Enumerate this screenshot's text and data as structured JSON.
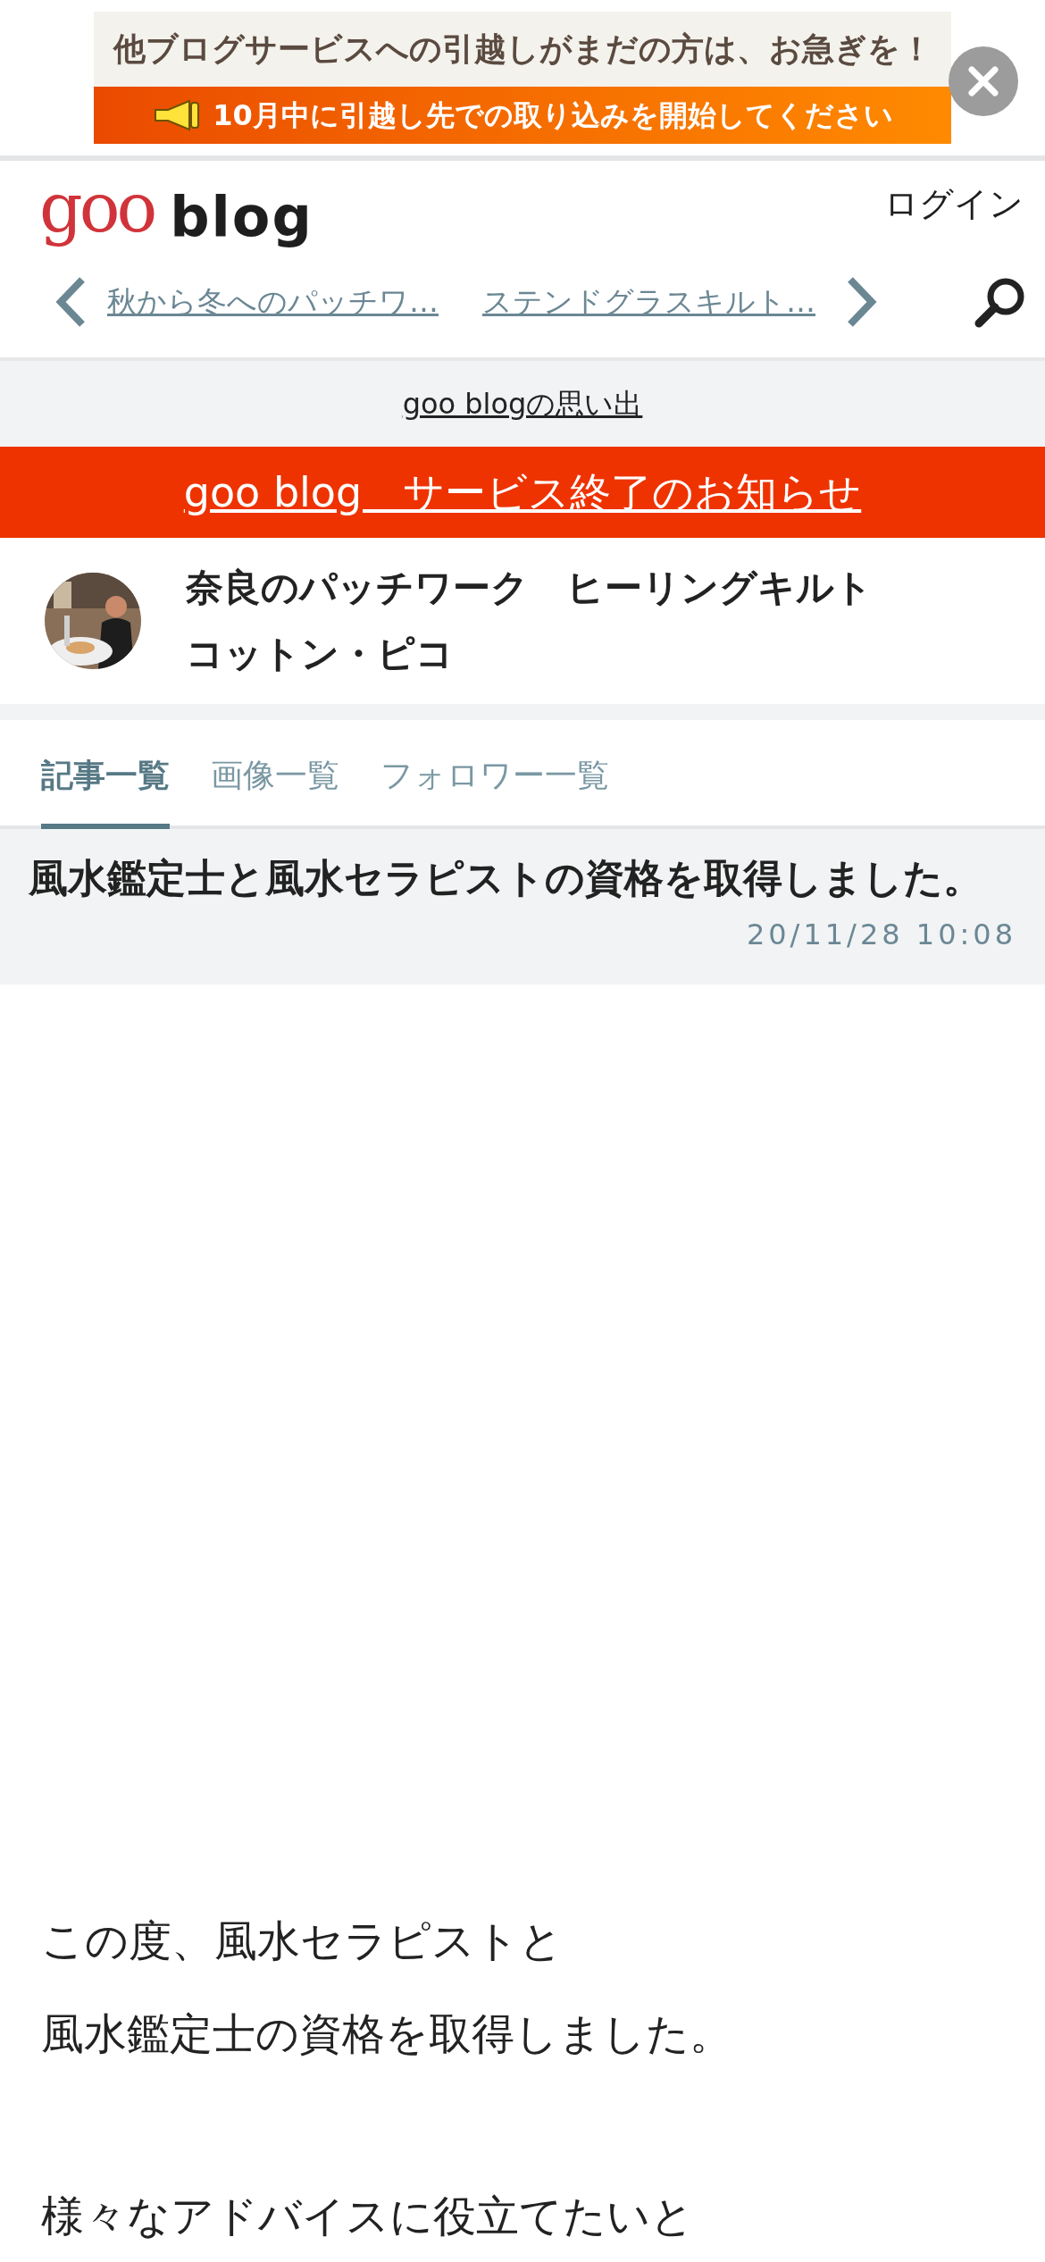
{
  "ad_banner": {
    "headline": "他ブログサービスへの引越しがまだの方は、お急ぎを！",
    "subline": "10月中に引越し先での取り込みを開始してください"
  },
  "header": {
    "logo_mark": "goo",
    "logo_text": "blog",
    "login": "ログイン"
  },
  "article_nav": {
    "previous": "秋から冬へのパッチワ…",
    "next": "ステンドグラスキルト…"
  },
  "memories_link": "goo blogの思い出",
  "notice_link": "goo blog　サービス終了のお知らせ",
  "blog": {
    "title_lines": [
      "奈良のパッチワーク　ヒーリングキルト",
      "コットン・ピコ"
    ]
  },
  "tabs": [
    {
      "label": "記事一覧",
      "selected": true
    },
    {
      "label": "画像一覧",
      "selected": false
    },
    {
      "label": "フォロワー一覧",
      "selected": false
    }
  ],
  "article": {
    "title": "風水鑑定士と風水セラピストの資格を取得しました。",
    "date": "20/11/28 10:08",
    "paragraphs": [
      [
        "この度、風水セラピストと",
        "風水鑑定士の資格を取得しました。"
      ],
      [
        "様々なアドバイスに役立てたいと"
      ]
    ]
  }
}
